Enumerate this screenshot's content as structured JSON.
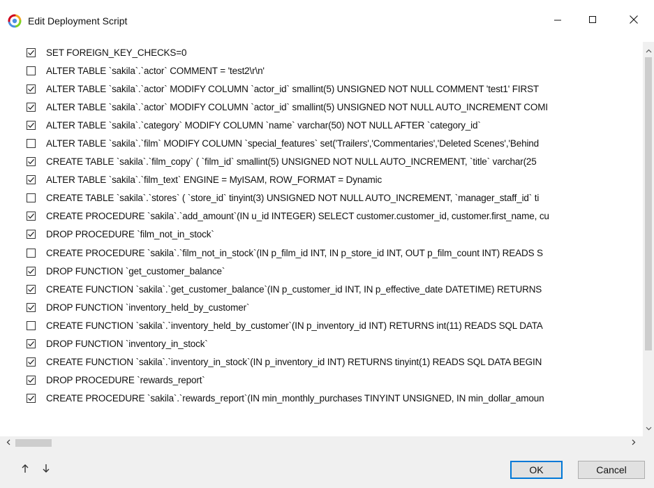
{
  "window": {
    "title": "Edit Deployment Script",
    "icons": {
      "app": "app-logo-icon",
      "minimize": "minimize-icon",
      "maximize": "maximize-icon",
      "close": "close-icon"
    }
  },
  "colors": {
    "accent": "#0078d7",
    "check": "#1a1a1a",
    "background": "#ffffff",
    "panel": "#f0f0f0"
  },
  "statements": [
    {
      "checked": true,
      "text": "SET FOREIGN_KEY_CHECKS=0"
    },
    {
      "checked": false,
      "text": "ALTER TABLE `sakila`.`actor` COMMENT = 'test2\\r\\n'"
    },
    {
      "checked": true,
      "text": "ALTER TABLE `sakila`.`actor` MODIFY COLUMN `actor_id` smallint(5) UNSIGNED NOT NULL COMMENT 'test1' FIRST"
    },
    {
      "checked": true,
      "text": "ALTER TABLE `sakila`.`actor` MODIFY COLUMN `actor_id` smallint(5) UNSIGNED NOT NULL AUTO_INCREMENT COMI"
    },
    {
      "checked": true,
      "text": "ALTER TABLE `sakila`.`category` MODIFY COLUMN `name` varchar(50) NOT NULL AFTER `category_id`"
    },
    {
      "checked": false,
      "text": "ALTER TABLE `sakila`.`film` MODIFY COLUMN `special_features` set('Trailers','Commentaries','Deleted Scenes','Behind"
    },
    {
      "checked": true,
      "text": "CREATE TABLE `sakila`.`film_copy` (  `film_id` smallint(5) UNSIGNED NOT NULL AUTO_INCREMENT,  `title` varchar(25"
    },
    {
      "checked": true,
      "text": "ALTER TABLE `sakila`.`film_text` ENGINE = MyISAM, ROW_FORMAT = Dynamic"
    },
    {
      "checked": false,
      "text": "CREATE TABLE `sakila`.`stores` (  `store_id` tinyint(3) UNSIGNED NOT NULL AUTO_INCREMENT,  `manager_staff_id` ti"
    },
    {
      "checked": true,
      "text": "CREATE PROCEDURE `sakila`.`add_amount`(IN u_id INTEGER) SELECT customer.customer_id, customer.first_name, cu"
    },
    {
      "checked": true,
      "text": "DROP PROCEDURE `film_not_in_stock`"
    },
    {
      "checked": false,
      "text": "CREATE PROCEDURE `sakila`.`film_not_in_stock`(IN p_film_id INT, IN p_store_id INT, OUT p_film_count INT)  READS S"
    },
    {
      "checked": true,
      "text": "DROP FUNCTION `get_customer_balance`"
    },
    {
      "checked": true,
      "text": "CREATE FUNCTION `sakila`.`get_customer_balance`(IN p_customer_id INT, IN p_effective_date DATETIME) RETURNS"
    },
    {
      "checked": true,
      "text": "DROP FUNCTION `inventory_held_by_customer`"
    },
    {
      "checked": false,
      "text": "CREATE FUNCTION `sakila`.`inventory_held_by_customer`(IN p_inventory_id INT) RETURNS int(11)  READS SQL DATA"
    },
    {
      "checked": true,
      "text": "DROP FUNCTION `inventory_in_stock`"
    },
    {
      "checked": true,
      "text": "CREATE FUNCTION `sakila`.`inventory_in_stock`(IN p_inventory_id INT) RETURNS tinyint(1)  READS SQL DATA BEGIN"
    },
    {
      "checked": true,
      "text": "DROP PROCEDURE `rewards_report`"
    },
    {
      "checked": true,
      "text": "CREATE PROCEDURE `sakila`.`rewards_report`(IN min_monthly_purchases TINYINT UNSIGNED, IN min_dollar_amoun"
    }
  ],
  "footer": {
    "move_up_icon": "arrow-up-icon",
    "move_down_icon": "arrow-down-icon",
    "ok_label": "OK",
    "cancel_label": "Cancel"
  }
}
